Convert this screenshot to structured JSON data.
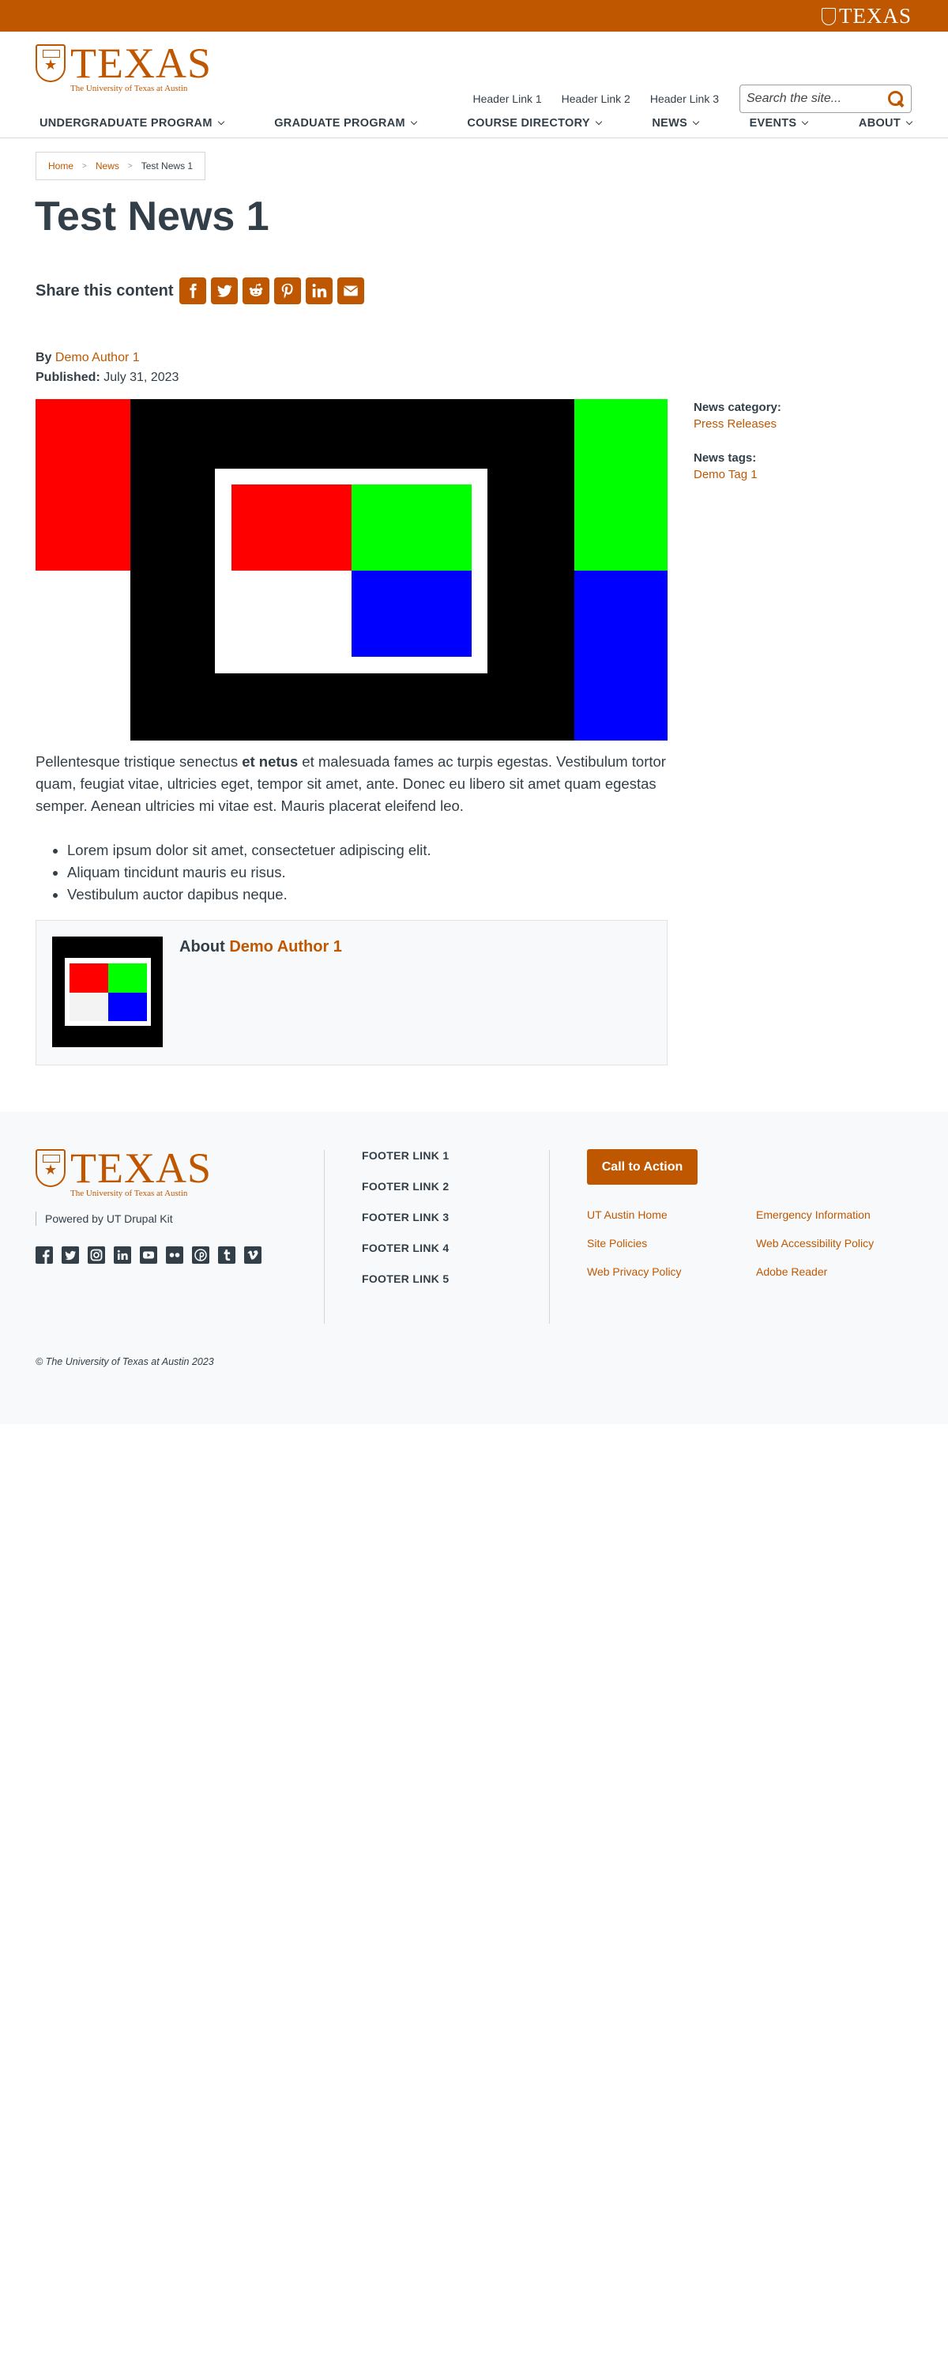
{
  "brand": {
    "bar_wordmark": "TEXAS",
    "logo_wordmark": "TEXAS",
    "logo_tagline": "The University of Texas at Austin",
    "accent_color": "#bf5700",
    "text_color": "#333f48"
  },
  "header": {
    "links": [
      "Header Link 1",
      "Header Link 2",
      "Header Link 3"
    ],
    "search_placeholder": "Search the site..."
  },
  "nav": {
    "items": [
      "UNDERGRADUATE PROGRAM",
      "GRADUATE PROGRAM",
      "COURSE DIRECTORY",
      "NEWS",
      "EVENTS",
      "ABOUT"
    ]
  },
  "breadcrumb": {
    "home": "Home",
    "news": "News",
    "current": "Test News 1"
  },
  "article": {
    "title": "Test News 1",
    "share_label": "Share this content",
    "share_icons": [
      "facebook-icon",
      "twitter-icon",
      "reddit-icon",
      "pinterest-icon",
      "linkedin-icon",
      "email-icon"
    ],
    "by_label": "By",
    "author": "Demo Author 1",
    "published_label": "Published:",
    "published_date": "July 31, 2023",
    "para_start": "Pellentesque tristique senectus ",
    "para_bold": "et netus",
    "para_end": " et malesuada fames ac turpis egestas. Vestibulum tortor quam, feugiat vitae, ultricies eget, tempor sit amet, ante. Donec eu libero sit amet quam egestas semper. Aenean ultricies mi vitae est. Mauris placerat eleifend leo.",
    "list": [
      "Lorem ipsum dolor sit amet, consectetuer adipiscing elit.",
      "Aliquam tincidunt mauris eu risus.",
      "Vestibulum auctor dapibus neque."
    ],
    "about_label": "About",
    "about_author": "Demo Author 1"
  },
  "sidebar": {
    "category_label": "News category:",
    "category": "Press Releases",
    "tags_label": "News tags:",
    "tag": "Demo Tag 1"
  },
  "footer": {
    "powered_by": "Powered by UT Drupal Kit",
    "social_icons": [
      "facebook-icon",
      "twitter-icon",
      "instagram-icon",
      "linkedin-icon",
      "youtube-icon",
      "flickr-icon",
      "pinterest-icon",
      "tumblr-icon",
      "vimeo-icon"
    ],
    "links": [
      "FOOTER LINK 1",
      "FOOTER LINK 2",
      "FOOTER LINK 3",
      "FOOTER LINK 4",
      "FOOTER LINK 5"
    ],
    "cta": "Call to Action",
    "utility_links": [
      "UT Austin Home",
      "Emergency Information",
      "Site Policies",
      "Web Accessibility Policy",
      "Web Privacy Policy",
      "Adobe Reader"
    ],
    "copyright": "© The University of Texas at Austin 2023"
  }
}
